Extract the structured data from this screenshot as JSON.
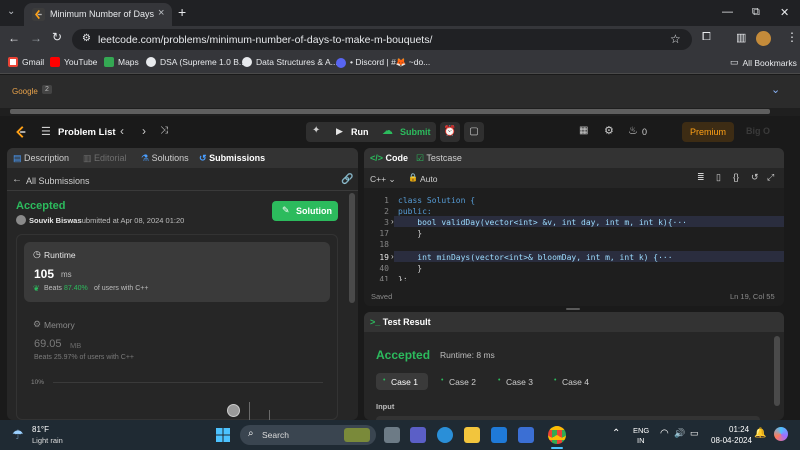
{
  "browser": {
    "tab_title": "Minimum Number of Days to M",
    "url": "leetcode.com/problems/minimum-number-of-days-to-make-m-bouquets/",
    "bookmarks": [
      "Gmail",
      "YouTube",
      "Maps",
      "DSA (Supreme 1.0 B...",
      "Data Structures & A...",
      "• Discord | #🦊 ~do...",
      "All Bookmarks"
    ]
  },
  "google_bar": {
    "label": "Google",
    "count": "2"
  },
  "nav": {
    "problem_list": "Problem List",
    "run": "Run",
    "submit": "Submit",
    "streak": "0",
    "premium": "Premium",
    "avatar_text": "Big O"
  },
  "left_panel": {
    "tabs": [
      "Description",
      "Editorial",
      "Solutions",
      "Submissions"
    ],
    "back_label": "All Submissions",
    "status": "Accepted",
    "user": "Souvik Biswas",
    "submitted_at": "submitted at Apr 08, 2024 01:20",
    "solution_button": "Solution",
    "runtime": {
      "label": "Runtime",
      "value": "105",
      "unit": "ms",
      "beats_prefix": "Beats",
      "beats_pct": "87.40%",
      "beats_suffix": "of users with C++"
    },
    "memory": {
      "label": "Memory",
      "value": "69.05",
      "unit": "MB",
      "beats_text": "Beats 25.97% of users with C++"
    },
    "chart_tick": "10%"
  },
  "editor": {
    "tab_code": "Code",
    "tab_testcase": "Testcase",
    "language": "C++",
    "mode": "Auto",
    "status": "Saved",
    "cursor": "Ln 19, Col 55",
    "lines": [
      {
        "n": "1",
        "text": "class Solution {"
      },
      {
        "n": "2",
        "text": "public:"
      },
      {
        "n": "3",
        "text": "    bool validDay(vector<int> &v, int day, int m, int k){···"
      },
      {
        "n": "17",
        "text": "    }"
      },
      {
        "n": "18",
        "text": ""
      },
      {
        "n": "19",
        "text": "    int minDays(vector<int>& bloomDay, int m, int k) {···"
      },
      {
        "n": "40",
        "text": "    }"
      },
      {
        "n": "41",
        "text": "};"
      }
    ]
  },
  "test_result": {
    "title": "Test Result",
    "status": "Accepted",
    "runtime": "Runtime: 8 ms",
    "cases": [
      "Case 1",
      "Case 2",
      "Case 3",
      "Case 4"
    ],
    "input_label": "Input"
  },
  "taskbar": {
    "temp": "81°F",
    "weather": "Light rain",
    "search": "Search",
    "lang": "ENG",
    "region": "IN",
    "time": "01:24",
    "date": "08-04-2024"
  }
}
